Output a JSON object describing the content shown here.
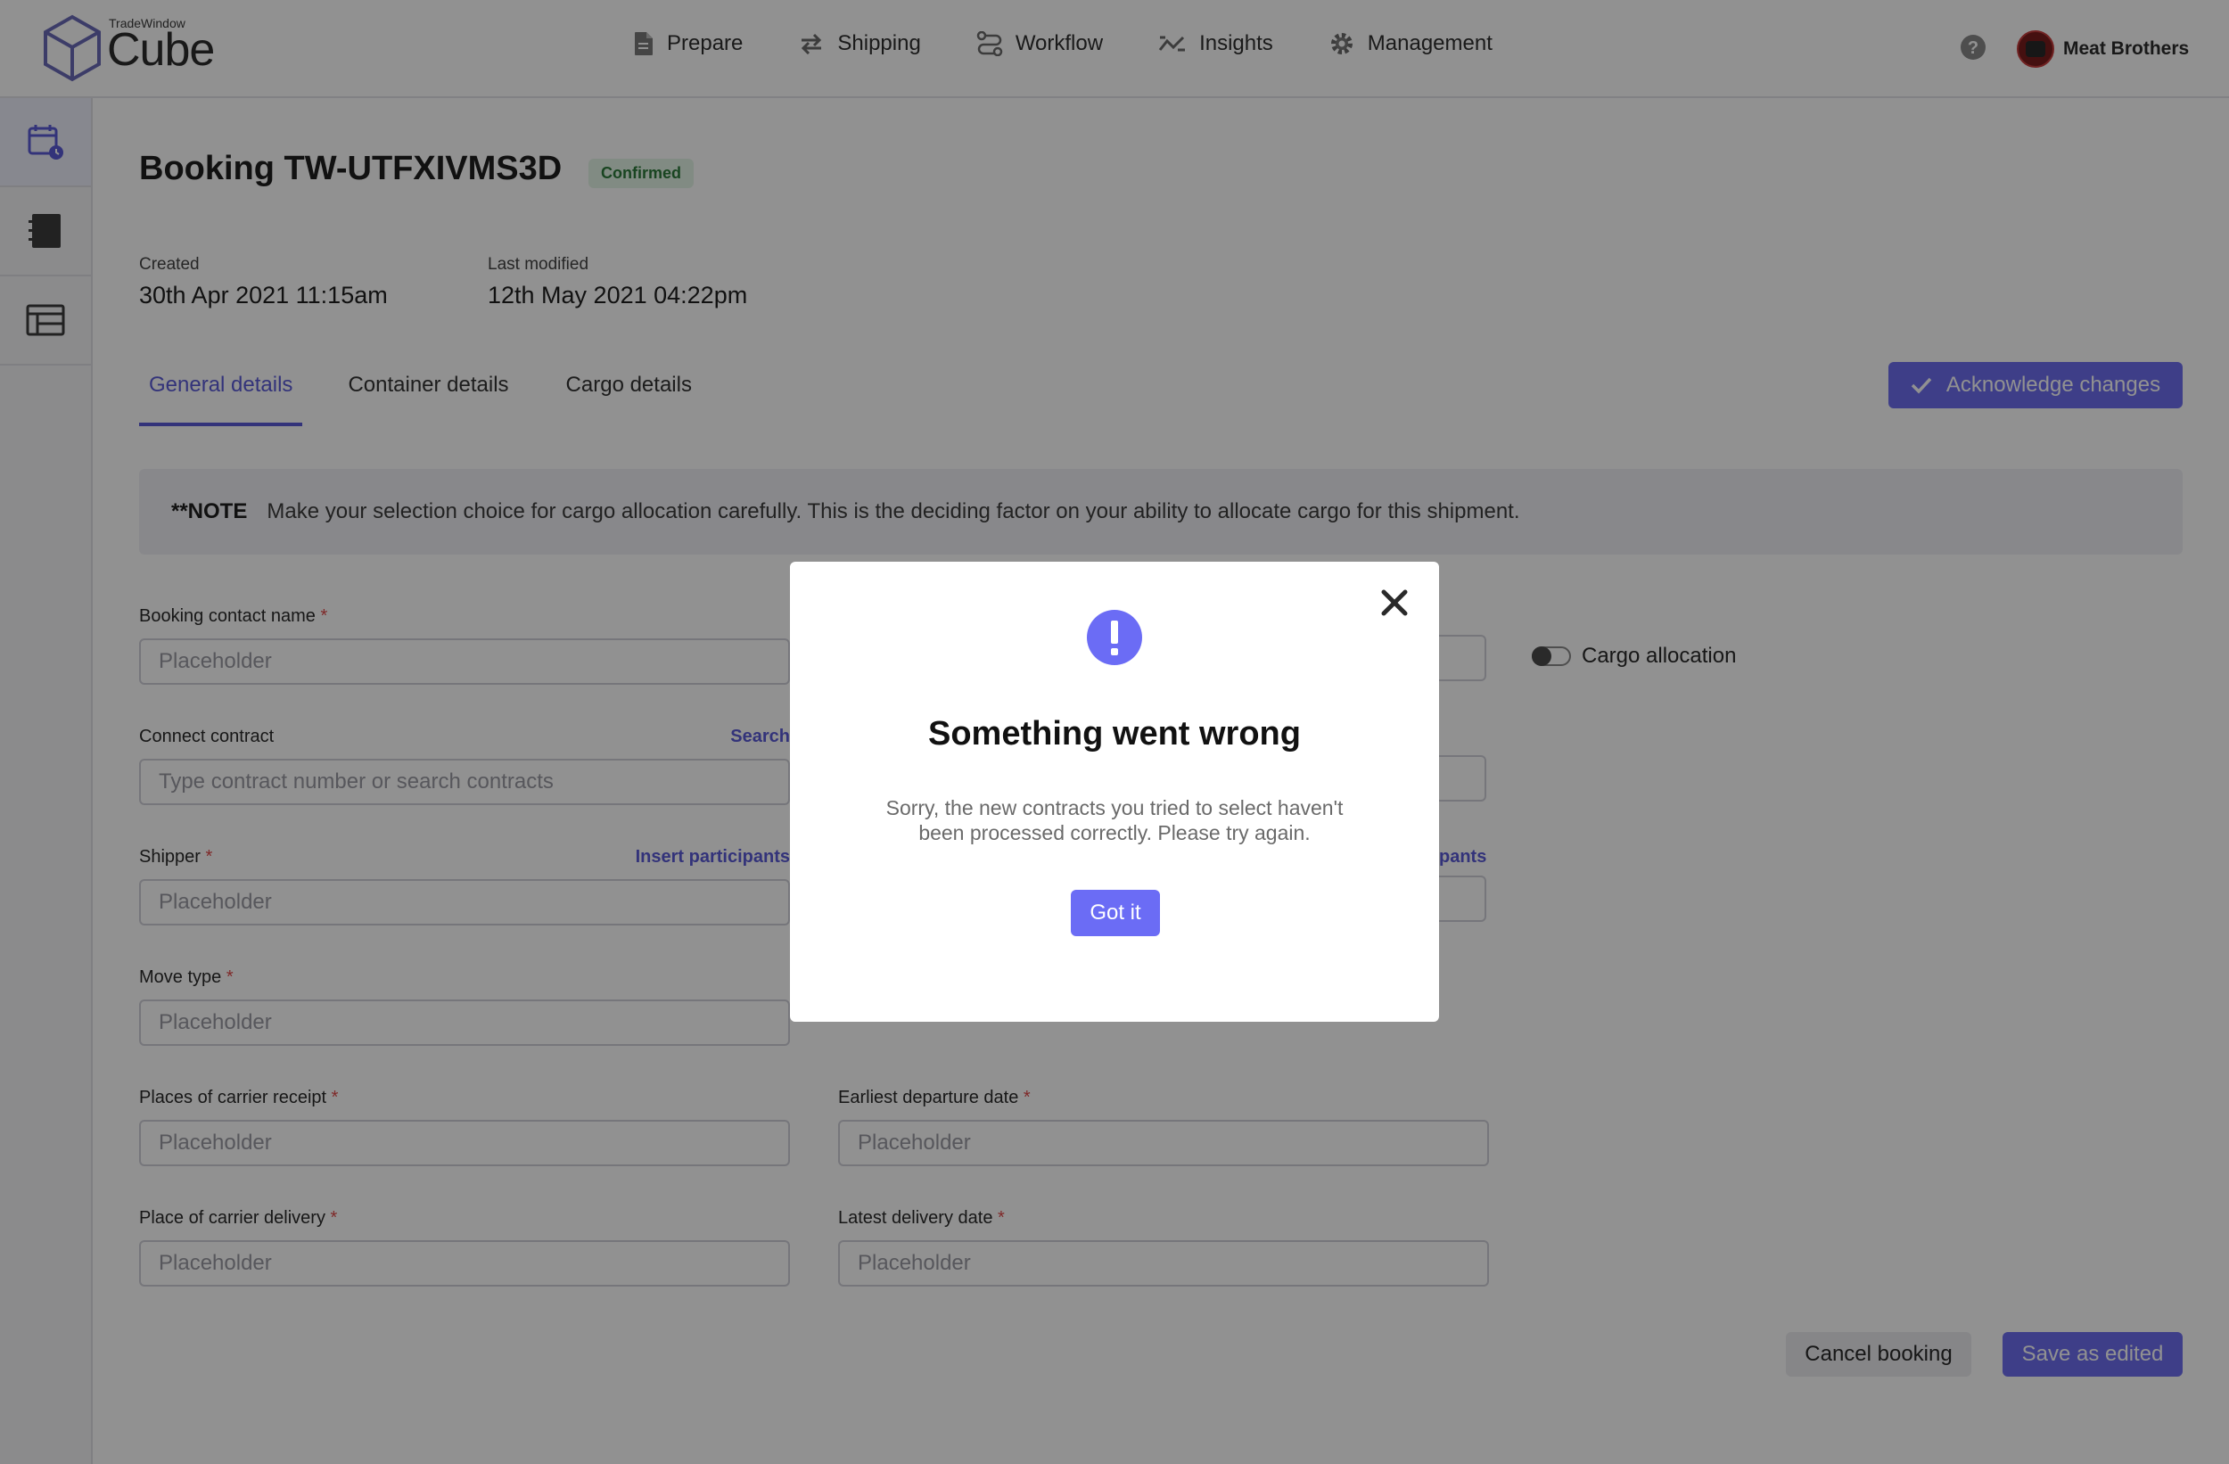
{
  "app": {
    "brand_small": "TradeWindow",
    "brand_big": "Cube"
  },
  "nav": [
    {
      "label": "Prepare",
      "icon": "document-icon"
    },
    {
      "label": "Shipping",
      "icon": "transfer-arrows-icon"
    },
    {
      "label": "Workflow",
      "icon": "workflow-icon"
    },
    {
      "label": "Insights",
      "icon": "trend-icon"
    },
    {
      "label": "Management",
      "icon": "gear-icon"
    }
  ],
  "user": {
    "name": "Meat Brothers"
  },
  "rail": [
    {
      "icon": "calendar-clock-icon",
      "active": true
    },
    {
      "icon": "notebook-icon",
      "active": false
    },
    {
      "icon": "list-table-icon",
      "active": false
    }
  ],
  "booking": {
    "title": "Booking TW-UTFXIVMS3D",
    "status": "Confirmed",
    "created_label": "Created",
    "created_value": "30th Apr 2021 11:15am",
    "modified_label": "Last modified",
    "modified_value": "12th May 2021 04:22pm"
  },
  "tabs": [
    {
      "label": "General details",
      "active": true
    },
    {
      "label": "Container details",
      "active": false
    },
    {
      "label": "Cargo details",
      "active": false
    }
  ],
  "actions": {
    "acknowledge": "Acknowledge changes",
    "cancel": "Cancel booking",
    "save": "Save as edited"
  },
  "note": {
    "tag": "**NOTE",
    "text": "Make your selection choice for cargo allocation carefully. This is the deciding factor on your ability to allocate cargo for this shipment."
  },
  "form": {
    "booking_contact": {
      "label": "Booking contact name",
      "placeholder": "Placeholder"
    },
    "connect_contract": {
      "label": "Connect contract",
      "link": "Search",
      "placeholder": "Type contract number or search contracts"
    },
    "shipper": {
      "label": "Shipper",
      "link": "Insert participants",
      "placeholder": "Placeholder"
    },
    "right_shipper_link": "pants",
    "move_type": {
      "label": "Move type",
      "placeholder": "Placeholder"
    },
    "carrier_receipt": {
      "label": "Places of carrier receipt",
      "placeholder": "Placeholder"
    },
    "departure_date": {
      "label": "Earliest departure date",
      "placeholder": "Placeholder"
    },
    "carrier_delivery": {
      "label": "Place of carrier delivery",
      "placeholder": "Placeholder"
    },
    "delivery_date": {
      "label": "Latest delivery date",
      "placeholder": "Placeholder"
    },
    "cargo_allocation": "Cargo allocation",
    "required_mark": "*"
  },
  "modal": {
    "title": "Something went wrong",
    "body": "Sorry, the new contracts you tried to select haven't been processed correctly. Please try again.",
    "button": "Got it"
  },
  "colors": {
    "accent": "#5b5bd6",
    "button": "#6d6ef0",
    "success_bg": "#e3f4e6",
    "success_text": "#2c7a3a",
    "required": "#e04848"
  }
}
